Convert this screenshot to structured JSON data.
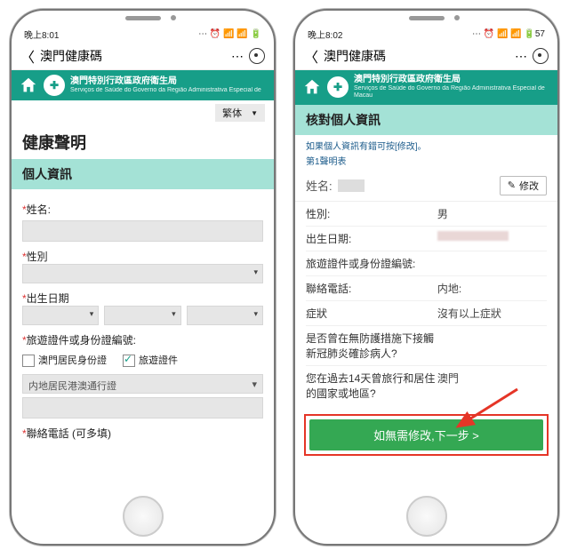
{
  "left": {
    "status": {
      "time": "晚上8:01",
      "icons": "⋯ ⏰ 📶 📶 🔋"
    },
    "nav": {
      "title": "澳門健康碼"
    },
    "org": {
      "line1": "澳門特別行政區政府衛生局",
      "line2": "Serviços de Saúde do Governo da Região Administrativa Especial de"
    },
    "lang": "繁体",
    "page_title": "健康聲明",
    "section": "個人資訊",
    "labels": {
      "name": "姓名:",
      "gender": "性別",
      "dob": "出生日期",
      "doc": "旅遊證件或身份證編號:",
      "check_resident": "澳門居民身份證",
      "check_travel": "旅遊證件",
      "mainland_doc": "内地居民港澳通行證",
      "phone": "聯絡電話 (可多填)"
    },
    "dd_caret": "▾"
  },
  "right": {
    "status": {
      "time": "晚上8:02",
      "icons": "⋯ ⏰ 📶 📶 🔋57"
    },
    "nav": {
      "title": "澳門健康碼"
    },
    "org": {
      "line1": "澳門特別行政區政府衛生局",
      "line2": "Serviços de Saúde do Governo da Região Administrativa Especial de Macau"
    },
    "section": "核對個人資訊",
    "note1": "如果個人資訊有錯可按[修改]。",
    "note2": "第1聲明表",
    "name_label": "姓名:",
    "edit_label": "修改",
    "rows": [
      {
        "k": "性別:",
        "v": "男"
      },
      {
        "k": "出生日期:",
        "v": ""
      },
      {
        "k": "旅遊證件或身份證編號:",
        "v": ""
      },
      {
        "k": "聯絡電話:",
        "v": "内地:"
      },
      {
        "k": "症狀",
        "v": "沒有以上症狀"
      },
      {
        "k": "是否曾在無防護措施下接觸新冠肺炎確診病人?",
        "v": ""
      },
      {
        "k": "您在過去14天曾旅行和居住的國家或地區?",
        "v": "澳門"
      }
    ],
    "next_label": "如無需修改,下一步 >"
  }
}
